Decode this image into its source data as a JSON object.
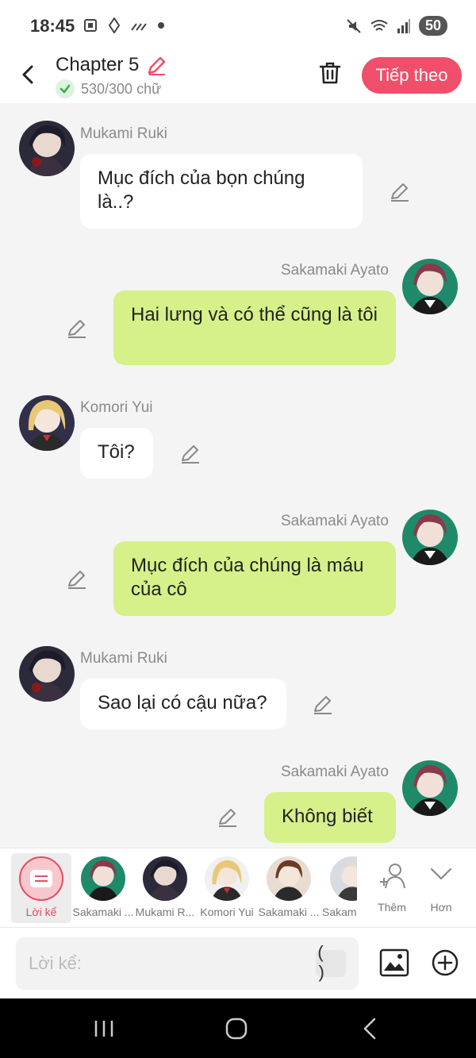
{
  "status_bar": {
    "time": "18:45",
    "battery": "50",
    "left_icons": [
      "screenshot-icon",
      "vpn-icon",
      "signal-bars-icon",
      "dot-icon"
    ],
    "right_icons": [
      "mute-icon",
      "wifi-icon",
      "cell-signal-icon"
    ]
  },
  "header": {
    "title": "Chapter 5",
    "word_count": "530/300 chữ",
    "next_button": "Tiếp theo"
  },
  "messages": [
    {
      "side": "left",
      "speaker": "Mukami Ruki",
      "text": "Mục đích của bọn chúng là..?"
    },
    {
      "side": "right",
      "speaker": "Sakamaki Ayato",
      "text": "Hai lưng và có thể cũng là tôi"
    },
    {
      "side": "left",
      "speaker": "Komori Yui",
      "text": "Tôi?"
    },
    {
      "side": "right",
      "speaker": "Sakamaki Ayato",
      "text": "Mục đích của chúng là máu của cô"
    },
    {
      "side": "left",
      "speaker": "Mukami Ruki",
      "text": "Sao lại có cậu nữa?"
    },
    {
      "side": "right",
      "speaker": "Sakamaki Ayato",
      "text": "Không biết"
    }
  ],
  "character_bar": {
    "narration": "Lời kể",
    "characters": [
      "Sakamaki ...",
      "Mukami R...",
      "Komori Yui",
      "Sakamaki ...",
      "Sakam"
    ],
    "add": "Thêm",
    "more": "Hơn"
  },
  "input": {
    "placeholder": "Lời kể:",
    "paren_label": "( )"
  },
  "colors": {
    "accent": "#ef4f6a",
    "right_bubble": "#d6f08a",
    "left_bubble": "#ffffff",
    "background": "#f4f4f4"
  }
}
